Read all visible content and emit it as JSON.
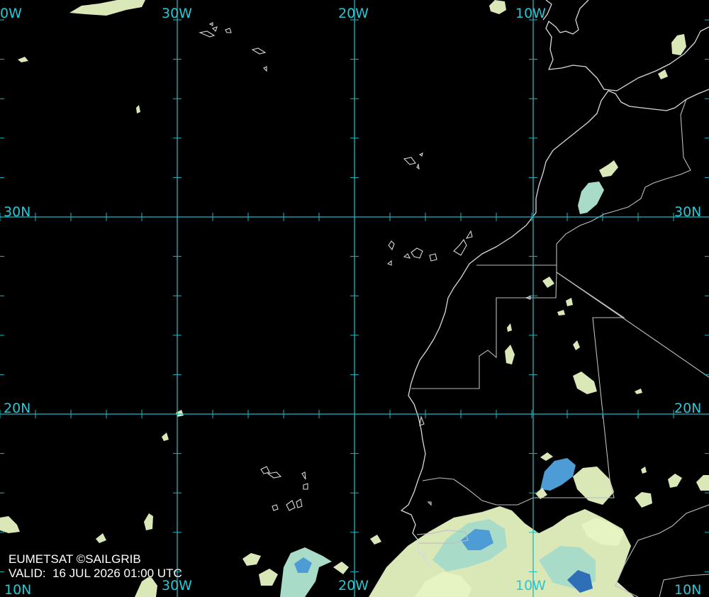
{
  "map": {
    "source": "EUMETSAT ©SAILGRIB",
    "valid_prefix": "VALID:",
    "valid_time": "16 JUL 2026 01:00 UTC",
    "longitude_labels": [
      "0W",
      "30W",
      "20W",
      "10W"
    ],
    "latitude_labels": [
      "30N",
      "20N"
    ],
    "bottom_labels": [
      "10N",
      "30W",
      "20W",
      "10W",
      "10N"
    ],
    "colors": {
      "background": "#000000",
      "grid": "#1bb7c4",
      "coastline": "#d9d9d9",
      "cloud_light": "#e6f4c2",
      "cloud_mid": "#a9dcc8",
      "cloud_blue": "#4d9cd6",
      "cloud_deep": "#2e6fb8"
    }
  }
}
